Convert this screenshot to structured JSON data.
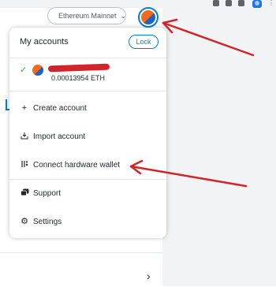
{
  "network": {
    "label": "Ethereum Mainnet",
    "status_color": "#29b6af"
  },
  "menu": {
    "title": "My accounts",
    "lock_label": "Lock",
    "account": {
      "balance": "0.00013954 ETH"
    },
    "items": [
      {
        "label": "Create account",
        "icon": "plus-icon"
      },
      {
        "label": "Import account",
        "icon": "import-icon"
      },
      {
        "label": "Connect hardware wallet",
        "icon": "hardware-wallet-icon"
      },
      {
        "label": "Support",
        "icon": "support-icon"
      },
      {
        "label": "Settings",
        "icon": "gear-icon"
      }
    ]
  },
  "colors": {
    "accent": "#037dd6",
    "annotation": "#d0262b",
    "check": "#28a745"
  }
}
